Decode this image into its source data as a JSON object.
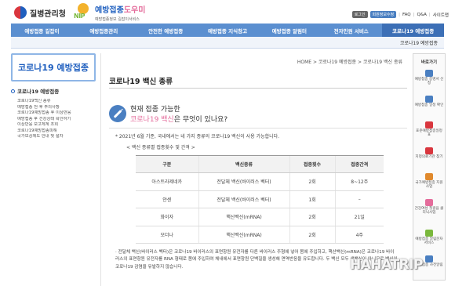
{
  "header": {
    "kdca_logo_text": "질병관리청",
    "nip_logo_mark": "NIP",
    "nip_title_a": "예방접종",
    "nip_title_b": "도우미",
    "nip_subtitle": "예방접종정보 길잡이서비스",
    "util_btn_1": "로그인",
    "util_btn_2": "회원정보수정",
    "util_faq": "FAQ",
    "util_qa": "Q&A",
    "util_sitemap": "사이트맵",
    "colors": {
      "brand_blue": "#1f5fbf",
      "nav_blue": "#5b8fd0",
      "accent_pink": "#e46c9b"
    }
  },
  "nav": {
    "items": [
      {
        "label": "예방접종 길잡이"
      },
      {
        "label": "예방접종관리"
      },
      {
        "label": "안전한 예방접종"
      },
      {
        "label": "예방접종 지식창고"
      },
      {
        "label": "예방접종 알림터"
      },
      {
        "label": "전자민원 서비스"
      },
      {
        "label": "코로나19 예방접종"
      }
    ],
    "sub_label": "코로나19 예방접종"
  },
  "sidebar": {
    "title": "코로나19 예방접종",
    "group": "코로나19 예방접종",
    "items": [
      "코로나19백신 종류",
      "예방접종 전·후 주의사항",
      "코로나19예방접종 후 이상반응",
      "예방접종 후 건강상태 확인하기",
      "이상반응 보고체계 조회",
      "코로나19예방접종피해",
      "국가보상제도 안내 및 절차"
    ]
  },
  "content": {
    "breadcrumb": "HOME > 코로나19 예방접종 > 코로나19 백신 종류",
    "page_title": "코로나19 백신 종류",
    "intro_line1": "현재 접종 가능한",
    "intro_hl": "코로나19 백신",
    "intro_rest": "은 무엇이 있나요?",
    "note": "* 2021년 6월 기준, 국내에서는 네 가지 종류의 코로나19 백신이 사용 가능합니다.",
    "table_caption": "< 백신 종류별 접종횟수 및 간격 >",
    "table": {
      "headers": [
        "구분",
        "백신종류",
        "접종횟수",
        "접종간격"
      ],
      "rows": [
        [
          "아스트라제네카",
          "전달체 백신(바이러스 벡터)",
          "2회",
          "8~12주"
        ],
        [
          "얀센",
          "전달체 백신(바이러스 벡터)",
          "1회",
          "–"
        ],
        [
          "화이자",
          "핵산백신(mRNA)",
          "2회",
          "21일"
        ],
        [
          "모더나",
          "핵산백신(mRNA)",
          "2회",
          "4주"
        ]
      ]
    },
    "footnote": "· 전달체 백신(바이러스 벡터)은 코로나19 바이러스의 표면항원 유전자를 다른 바이러스 주형에 넣어 몸에 주입하고, 핵산백신(mRNA)은 코로나19 바이러스의 표면항원 유전자를 RNA 형태로 몸에 주입하여 체내에서 표면항원 단백질을 생성해 면역반응을 유도합니다. 두 백신 모두 생백신이 아니므로 백신이 코로나19 감염을 유발하지 않습니다."
  },
  "quick_menu": {
    "title": "바로가기",
    "items": [
      {
        "label": "예방접종 증명서 신청",
        "icon": "certificate-icon",
        "color": "#4a7fc1"
      },
      {
        "label": "예방접종 일정 확인",
        "icon": "calendar-icon",
        "color": "#4a7fc1"
      },
      {
        "label": "표준예방접종일정표",
        "icon": "schedule-icon",
        "color": "#d9363e"
      },
      {
        "label": "지정의료기관 찾기",
        "icon": "hospital-icon",
        "color": "#d9363e"
      },
      {
        "label": "국가예방접종 지원사업",
        "icon": "support-icon",
        "color": "#e0892c"
      },
      {
        "label": "건강여성 첫걸음 클리닉사업",
        "icon": "clinic-icon",
        "color": "#e46c9b"
      },
      {
        "label": "예방접종 알림문자 서비스",
        "icon": "speaker-icon",
        "color": "#7ab83c"
      },
      {
        "label": "예방접종 사전알림",
        "icon": "phone-icon",
        "color": "#4a7fc1"
      }
    ]
  },
  "watermark": "HAHATRIP"
}
